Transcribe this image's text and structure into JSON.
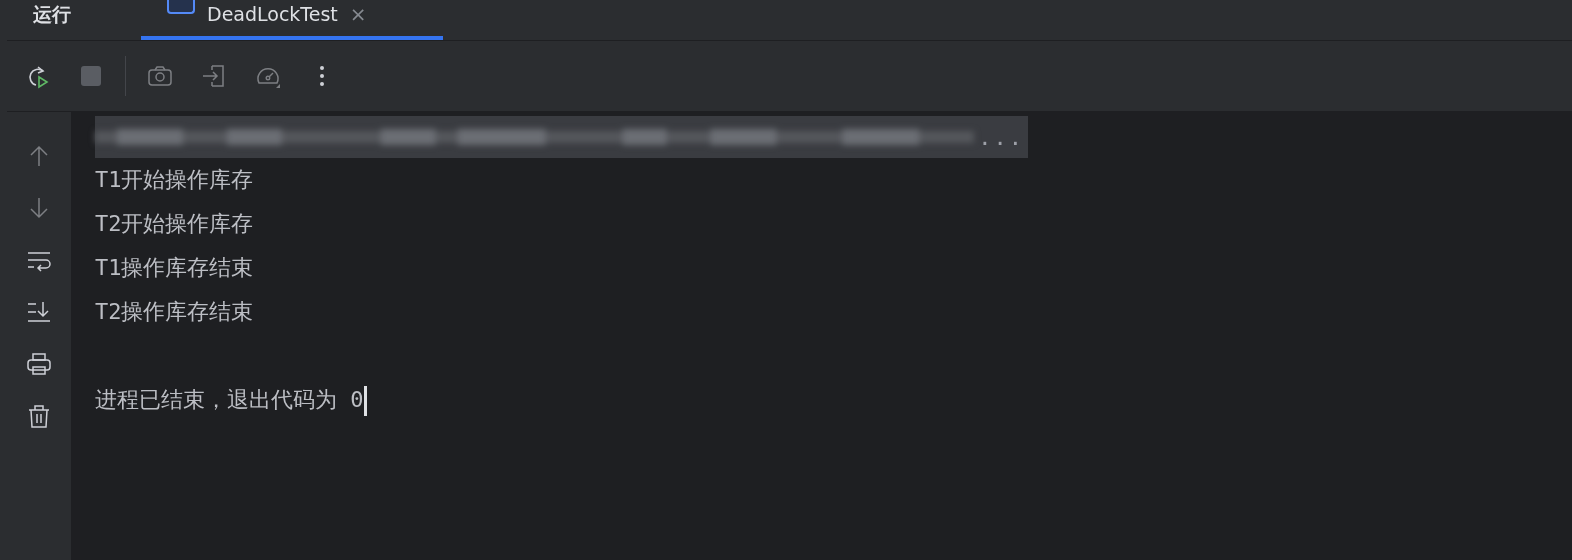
{
  "header": {
    "title": "运行",
    "tabs": [
      {
        "label": "DeadLockTest",
        "selected": true,
        "close": "×"
      }
    ]
  },
  "toolbar": {
    "buttons": [
      {
        "kind": "rerun",
        "disabled": false
      },
      {
        "kind": "stop",
        "disabled": false
      },
      {
        "kind": "camera",
        "disabled": true
      },
      {
        "kind": "login",
        "disabled": true
      },
      {
        "kind": "gauge",
        "disabled": true
      },
      {
        "kind": "more",
        "disabled": false
      }
    ]
  },
  "gutter": {
    "buttons": [
      {
        "kind": "up",
        "disabled": true
      },
      {
        "kind": "down",
        "disabled": true
      },
      {
        "kind": "wrap",
        "disabled": false
      },
      {
        "kind": "scroll-end",
        "disabled": false
      },
      {
        "kind": "print",
        "disabled": false
      },
      {
        "kind": "trash",
        "disabled": false
      }
    ]
  },
  "console": {
    "command_fold": "...",
    "lines": [
      "T1开始操作库存",
      "T2开始操作库存",
      "T1操作库存结束",
      "T2操作库存结束"
    ],
    "exit_message": "进程已结束，退出代码为 0"
  }
}
